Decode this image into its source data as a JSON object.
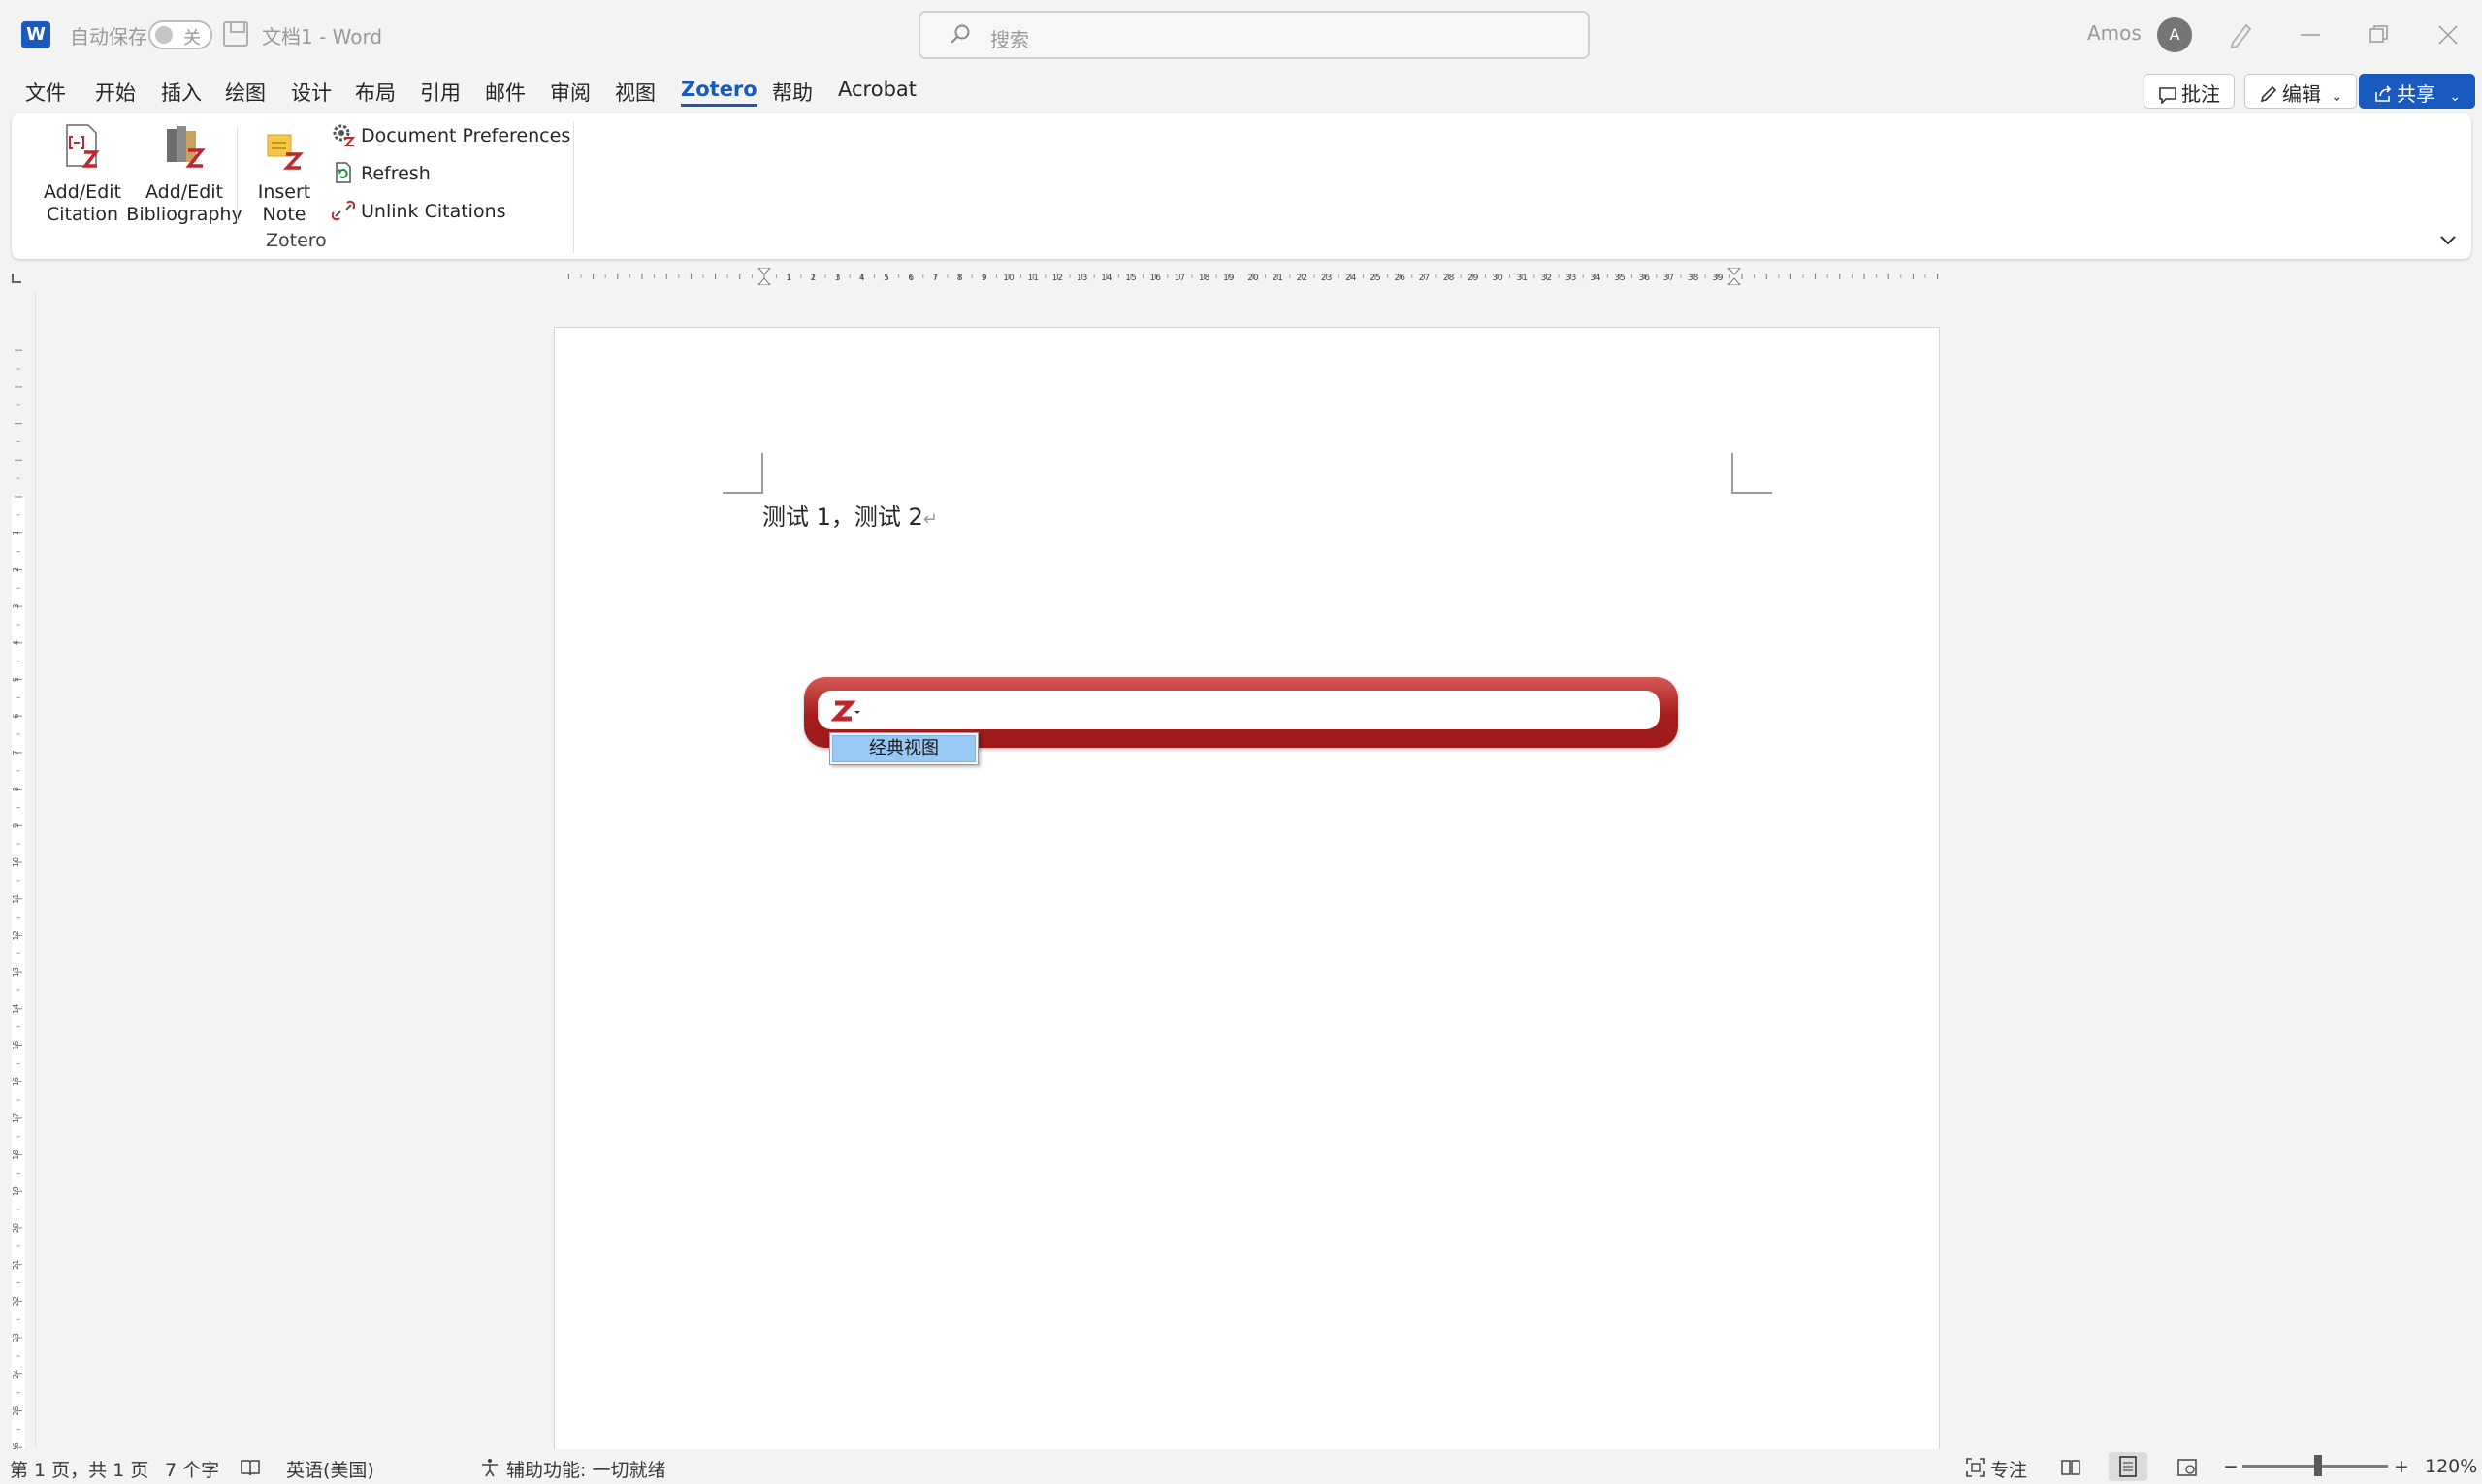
{
  "titlebar": {
    "app_logo": "W",
    "autosave_label": "自动保存",
    "autosave_state": "关",
    "doc_title": "文档1  -  Word",
    "search_placeholder": "搜索",
    "user_name": "Amos",
    "avatar_initial": "A"
  },
  "menu": {
    "tabs": [
      "文件",
      "开始",
      "插入",
      "绘图",
      "设计",
      "布局",
      "引用",
      "邮件",
      "审阅",
      "视图",
      "Zotero",
      "帮助",
      "Acrobat"
    ],
    "active_tab": "Zotero",
    "comment_label": "批注",
    "edit_label": "编辑",
    "share_label": "共享"
  },
  "ribbon": {
    "add_edit_citation": [
      "Add/Edit",
      "Citation"
    ],
    "add_edit_bibliography": [
      "Add/Edit",
      "Bibliography"
    ],
    "insert_note": [
      "Insert",
      "Note"
    ],
    "document_preferences": "Document Preferences",
    "refresh": "Refresh",
    "unlink_citations": "Unlink Citations",
    "group_label": "Zotero"
  },
  "ruler": {
    "numbers": [
      "1",
      "2",
      "3",
      "4",
      "5",
      "6",
      "7",
      "8",
      "9",
      "10",
      "11",
      "12",
      "13",
      "14",
      "15",
      "16",
      "17",
      "18",
      "19",
      "20",
      "21",
      "22",
      "23",
      "24",
      "25",
      "26",
      "27",
      "28",
      "29",
      "30",
      "31",
      "32",
      "33",
      "34",
      "35",
      "36",
      "37",
      "38",
      "39"
    ]
  },
  "document": {
    "text": "测试 1，测试 2",
    "para_mark": "↵"
  },
  "zotero": {
    "menu_item": "经典视图"
  },
  "status": {
    "page": "第 1 页，共 1 页",
    "words": "7 个字",
    "language": "英语(美国)",
    "accessibility": "辅助功能: 一切就绪",
    "focus": "专注",
    "zoom_minus": "−",
    "zoom_plus": "+",
    "zoom": "120%",
    "zoom_level": 1.2
  },
  "colors": {
    "word_blue": "#185abd",
    "zotero_red": "#a51c1c",
    "menu_highlight": "#99c8f5"
  }
}
